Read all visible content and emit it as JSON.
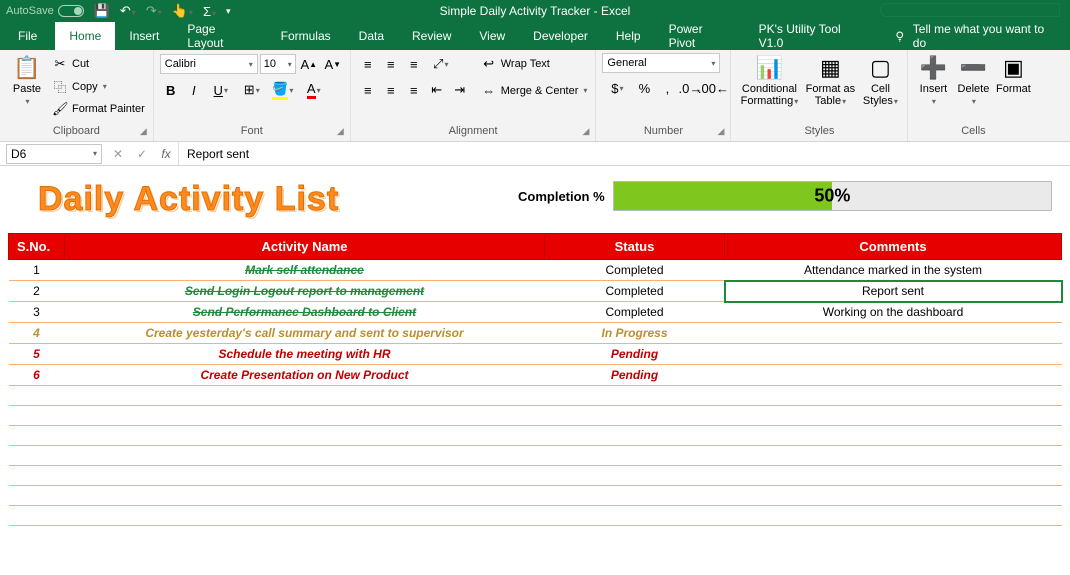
{
  "titlebar": {
    "autosave": "AutoSave",
    "title": "Simple Daily Activity Tracker  -  Excel"
  },
  "tabs": {
    "file": "File",
    "home": "Home",
    "insert": "Insert",
    "pagelayout": "Page Layout",
    "formulas": "Formulas",
    "data": "Data",
    "review": "Review",
    "view": "View",
    "developer": "Developer",
    "help": "Help",
    "powerpivot": "Power Pivot",
    "pkutil": "PK's Utility Tool V1.0",
    "tellme": "Tell me what you want to do"
  },
  "ribbon": {
    "clipboard": {
      "paste": "Paste",
      "cut": "Cut",
      "copy": "Copy",
      "fmtpainter": "Format Painter",
      "label": "Clipboard"
    },
    "font": {
      "name": "Calibri",
      "size": "10",
      "label": "Font"
    },
    "alignment": {
      "wrap": "Wrap Text",
      "merge": "Merge & Center",
      "label": "Alignment"
    },
    "number": {
      "format": "General",
      "label": "Number"
    },
    "styles": {
      "cond": "Conditional Formatting",
      "table": "Format as Table",
      "cell": "Cell Styles",
      "label": "Styles"
    },
    "cells": {
      "insert": "Insert",
      "delete": "Delete",
      "format": "Format",
      "label": "Cells"
    }
  },
  "formulabar": {
    "cellref": "D6",
    "value": "Report sent"
  },
  "sheet": {
    "title": "Daily Activity List",
    "completion_label": "Completion %",
    "completion_value": "50%",
    "headers": {
      "sno": "S.No.",
      "activity": "Activity Name",
      "status": "Status",
      "comments": "Comments"
    },
    "rows": [
      {
        "n": "1",
        "activity": "Mark self attendance",
        "status": "Completed",
        "comments": "Attendance marked in the system",
        "cls": "completed"
      },
      {
        "n": "2",
        "activity": "Send Login Logout report to management",
        "status": "Completed",
        "comments": "Report sent",
        "cls": "completed selected"
      },
      {
        "n": "3",
        "activity": "Send Performance Dashboard to Client",
        "status": "Completed",
        "comments": "Working on the dashboard",
        "cls": "completed"
      },
      {
        "n": "4",
        "activity": "Create yesterday's call summary and sent to supervisor",
        "status": "In Progress",
        "comments": "",
        "cls": "inprogress"
      },
      {
        "n": "5",
        "activity": "Schedule the meeting with HR",
        "status": "Pending",
        "comments": "",
        "cls": "pending"
      },
      {
        "n": "6",
        "activity": "Create Presentation on New Product",
        "status": "Pending",
        "comments": "",
        "cls": "pending"
      }
    ]
  },
  "chart_data": {
    "type": "bar",
    "title": "Completion %",
    "categories": [
      "Completion"
    ],
    "values": [
      50
    ],
    "ylim": [
      0,
      100
    ]
  }
}
